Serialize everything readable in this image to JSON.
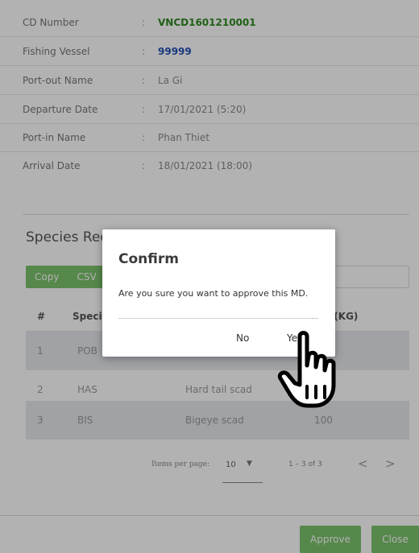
{
  "details": [
    {
      "label": "CD Number",
      "separator": ":",
      "value": "VNCD1601210001"
    },
    {
      "label": "Fishing Vessel",
      "separator": ":",
      "value": "99999"
    },
    {
      "label": "Port-out Name",
      "separator": ":",
      "value": "La Gi"
    },
    {
      "label": "Departure Date",
      "separator": ":",
      "value": "17/01/2021 (5:20)"
    },
    {
      "label": "Port-in Name",
      "separator": ":",
      "value": "Phan Thiet"
    },
    {
      "label": "Arrival Date",
      "separator": ":",
      "value": "18/01/2021 (18:00)"
    }
  ],
  "section": {
    "title": "Species Requ"
  },
  "toolbar": {
    "copy_label": "Copy",
    "csv_label": "CSV"
  },
  "table": {
    "headers": [
      "#",
      "Speci",
      "nt(KG)"
    ],
    "rows": [
      {
        "index": "1",
        "code": "POB",
        "name": "",
        "weight": ""
      },
      {
        "index": "2",
        "code": "HAS",
        "name": "Hard tail scad",
        "weight": ""
      },
      {
        "index": "3",
        "code": "BIS",
        "name": "Bigeye scad",
        "weight": "100"
      }
    ]
  },
  "paginator": {
    "items_label": "Items per page:",
    "page_size": "10",
    "range": "1 – 3 of 3",
    "prev": "<",
    "next": ">"
  },
  "footer": {
    "approve_label": "Approve",
    "close_label": "Close"
  },
  "dialog": {
    "title": "Confirm",
    "message": "Are you sure you want to approve this MD.",
    "no_label": "No",
    "yes_label": "Yes"
  },
  "colors": {
    "accent_green": "#7bc26c",
    "cd_number": "#2f8a22",
    "vessel": "#2452b5"
  },
  "icons": {
    "cursor": "hand-pointer-icon",
    "dropdown": "triangle-down-icon"
  }
}
